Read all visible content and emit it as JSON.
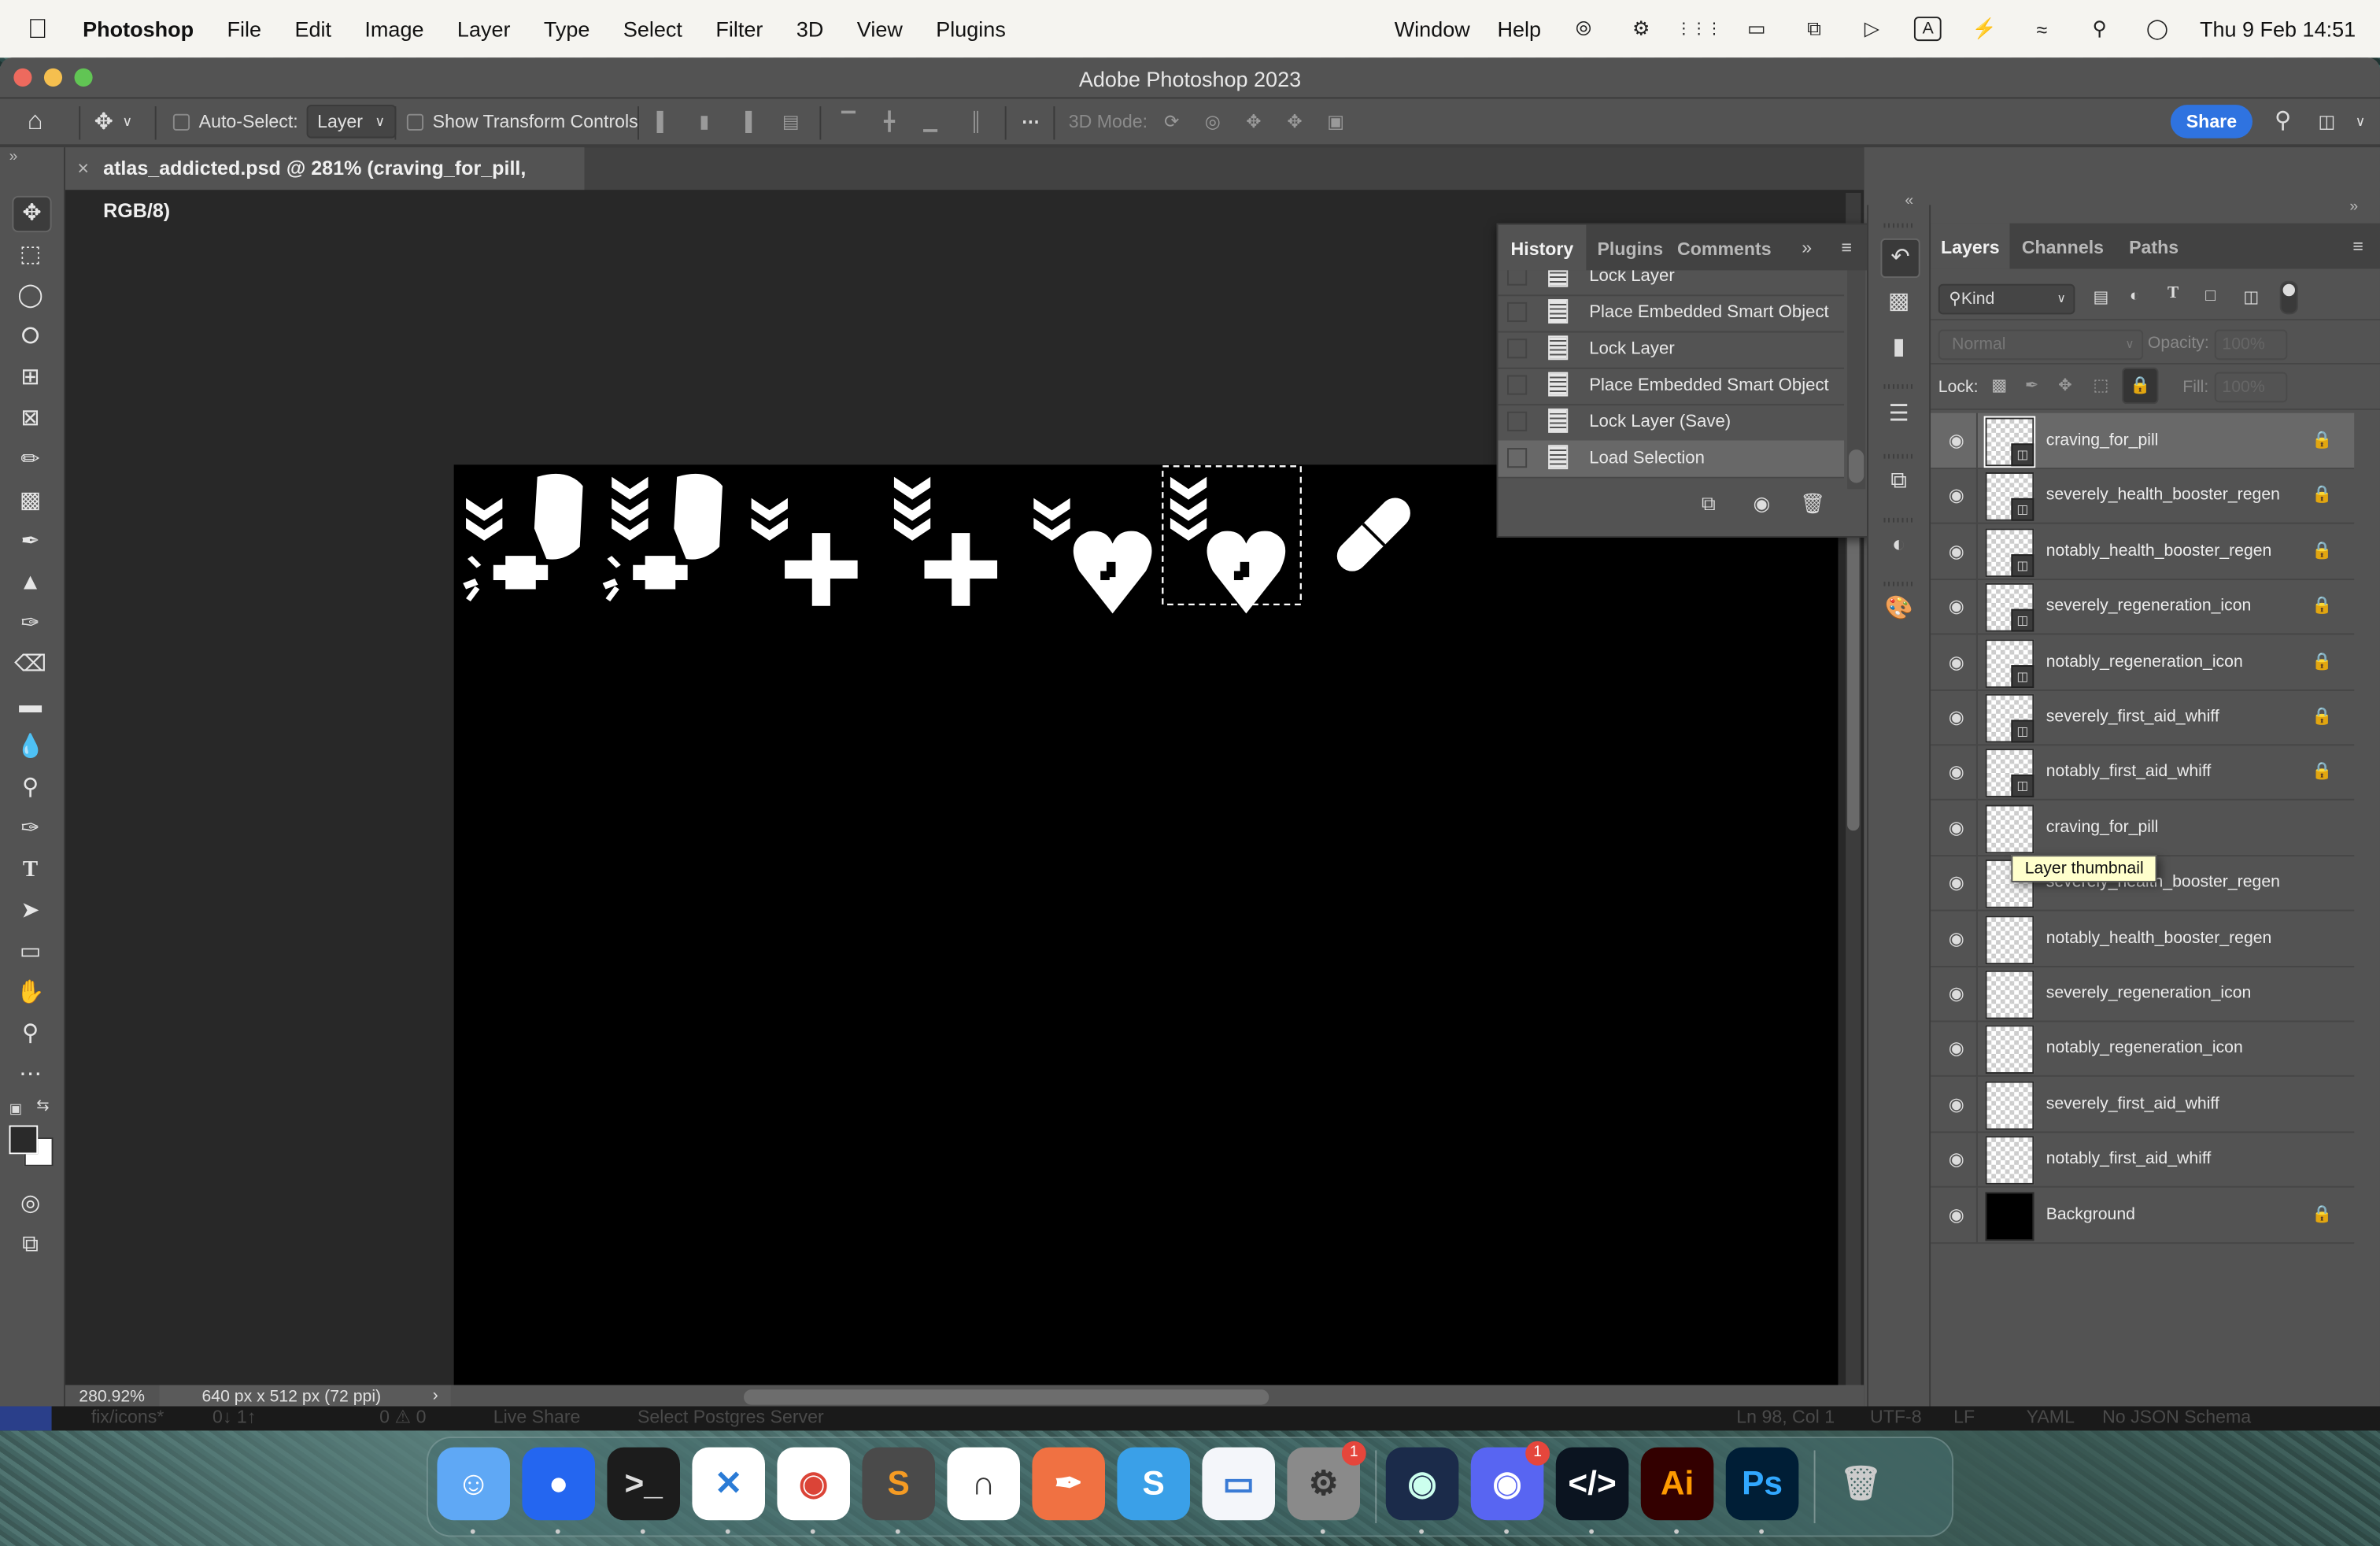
{
  "menubar": {
    "apple": "",
    "app_name": "Photoshop",
    "items": [
      "File",
      "Edit",
      "Image",
      "Layer",
      "Type",
      "Select",
      "Filter",
      "3D",
      "View",
      "Plugins"
    ],
    "right_items": [
      "Window",
      "Help"
    ],
    "status_icons": [
      "creative-cloud-icon",
      "vpn-lock-icon",
      "dots-grid-icon",
      "display-icon",
      "screen-mirror-icon",
      "play-circle-icon",
      "input-source-icon",
      "battery-charging-icon",
      "wifi-icon",
      "spotlight-search-icon",
      "control-center-icon"
    ],
    "input_source": "A",
    "clock": "Thu 9 Feb  14:51"
  },
  "window": {
    "title": "Adobe Photoshop 2023"
  },
  "options_bar": {
    "auto_select_label": "Auto-Select:",
    "auto_select_checked": false,
    "auto_select_target": "Layer",
    "show_transform_label": "Show Transform Controls",
    "show_transform_checked": false,
    "mode_3d_label": "3D Mode:",
    "share_label": "Share"
  },
  "document": {
    "tab_title": "atlas_addicted.psd @ 281% (craving_for_pill, RGB/8)",
    "zoom": "280.92%",
    "dimensions": "640 px x 512 px (72 ppi)"
  },
  "history": {
    "tabs": [
      "History",
      "Plugins",
      "Comments"
    ],
    "active_tab": "History",
    "items": [
      {
        "label": "Lock Layer",
        "selected": false
      },
      {
        "label": "Place Embedded Smart Object",
        "selected": false
      },
      {
        "label": "Lock Layer",
        "selected": false
      },
      {
        "label": "Place Embedded Smart Object",
        "selected": false
      },
      {
        "label": "Lock Layer (Save)",
        "selected": false
      },
      {
        "label": "Load Selection",
        "selected": true
      }
    ]
  },
  "layers_panel": {
    "tabs": [
      "Layers",
      "Channels",
      "Paths"
    ],
    "active_tab": "Layers",
    "filter_kind": "Kind",
    "blend_mode": "Normal",
    "opacity_label": "Opacity:",
    "opacity": "100%",
    "lock_label": "Lock:",
    "fill_label": "Fill:",
    "fill": "100%",
    "layers": [
      {
        "name": "craving_for_pill",
        "smart": true,
        "locked": true,
        "selected": true,
        "visible": true
      },
      {
        "name": "severely_health_booster_regen",
        "smart": true,
        "locked": true,
        "selected": false,
        "visible": true
      },
      {
        "name": "notably_health_booster_regen",
        "smart": true,
        "locked": true,
        "selected": false,
        "visible": true
      },
      {
        "name": "severely_regeneration_icon",
        "smart": true,
        "locked": true,
        "selected": false,
        "visible": true
      },
      {
        "name": "notably_regeneration_icon",
        "smart": true,
        "locked": true,
        "selected": false,
        "visible": true
      },
      {
        "name": "severely_first_aid_whiff",
        "smart": true,
        "locked": true,
        "selected": false,
        "visible": true
      },
      {
        "name": "notably_first_aid_whiff",
        "smart": true,
        "locked": true,
        "selected": false,
        "visible": true
      },
      {
        "name": "craving_for_pill",
        "smart": false,
        "locked": false,
        "selected": false,
        "visible": true
      },
      {
        "name": "severely_health_booster_regen",
        "smart": false,
        "locked": false,
        "selected": false,
        "visible": true
      },
      {
        "name": "notably_health_booster_regen",
        "smart": false,
        "locked": false,
        "selected": false,
        "visible": true
      },
      {
        "name": "severely_regeneration_icon",
        "smart": false,
        "locked": false,
        "selected": false,
        "visible": true
      },
      {
        "name": "notably_regeneration_icon",
        "smart": false,
        "locked": false,
        "selected": false,
        "visible": true
      },
      {
        "name": "severely_first_aid_whiff",
        "smart": false,
        "locked": false,
        "selected": false,
        "visible": true
      },
      {
        "name": "notably_first_aid_whiff",
        "smart": false,
        "locked": false,
        "selected": false,
        "visible": true
      },
      {
        "name": "Background",
        "smart": false,
        "locked": true,
        "selected": false,
        "visible": true,
        "black": true
      }
    ],
    "tooltip": "Layer thumbnail"
  },
  "vscode_status": {
    "left": [
      "fix/icons*",
      "0↓ 1↑",
      "0 ⚠ 0",
      "Live Share",
      "Select Postgres Server"
    ],
    "right": [
      "Ln 98, Col 1",
      "UTF-8",
      "LF",
      "YAML",
      "No JSON Schema"
    ]
  },
  "dock": {
    "apps": [
      {
        "name": "Finder",
        "badge": null,
        "running": true
      },
      {
        "name": "Maps Pin",
        "badge": null,
        "running": true
      },
      {
        "name": "Terminal",
        "badge": null,
        "running": true
      },
      {
        "name": "Visual Studio Code",
        "badge": null,
        "running": true
      },
      {
        "name": "Google Chrome",
        "badge": null,
        "running": true
      },
      {
        "name": "Sublime Text",
        "badge": null,
        "running": true
      },
      {
        "name": "Insomnia",
        "badge": null,
        "running": false
      },
      {
        "name": "Postman",
        "badge": null,
        "running": false
      },
      {
        "name": "Skype",
        "badge": null,
        "running": false
      },
      {
        "name": "Keynote",
        "badge": null,
        "running": false
      },
      {
        "name": "System Settings",
        "badge": "1",
        "running": true
      },
      {
        "name": "Steam",
        "badge": null,
        "running": true
      },
      {
        "name": "Discord",
        "badge": "1",
        "running": true
      },
      {
        "name": "DevToys",
        "badge": null,
        "running": true
      },
      {
        "name": "Adobe Illustrator",
        "badge": null,
        "running": true
      },
      {
        "name": "Adobe Photoshop",
        "badge": null,
        "running": true
      },
      {
        "name": "Trash",
        "badge": null,
        "running": false
      }
    ],
    "labels": {
      "illustrator": "Ai",
      "photoshop": "Ps",
      "skype": "S"
    }
  },
  "colors": {
    "accent": "#2f73e0",
    "panel": "#535353",
    "canvas": "#000000",
    "tooltip_bg": "#ffffcc"
  }
}
